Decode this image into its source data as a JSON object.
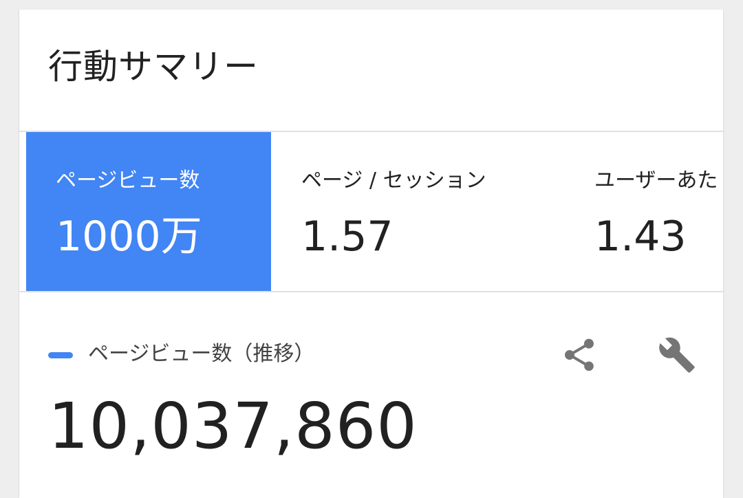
{
  "card": {
    "title": "行動サマリー"
  },
  "tabs": [
    {
      "label": "ページビュー数",
      "value": "1000万",
      "selected": true
    },
    {
      "label": "ページ / セッション",
      "value": "1.57",
      "selected": false
    },
    {
      "label": "ユーザーあた",
      "value": "1.43",
      "selected": false
    }
  ],
  "metric": {
    "legend_label": "ページビュー数（推移）",
    "legend_color": "#4285f4",
    "value": "10,037,860"
  },
  "icons": {
    "share": "share-icon",
    "settings": "wrench-icon"
  },
  "colors": {
    "accent": "#4285f4",
    "icon": "#757575",
    "text": "#212121"
  }
}
